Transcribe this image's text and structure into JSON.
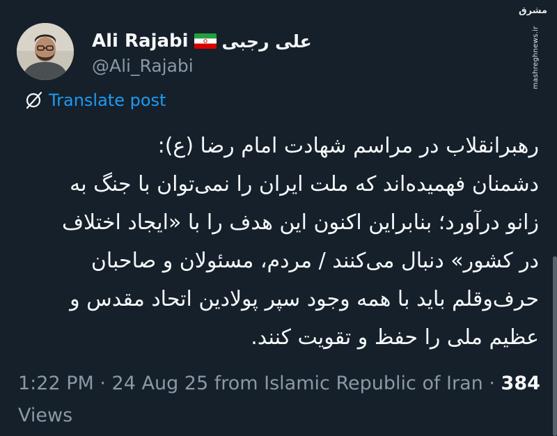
{
  "author": {
    "display_name": "Ali Rajabi",
    "flag_icon": "iran-flag-icon",
    "alt_name": "علی رجبی",
    "handle": "@Ali_Rajabi"
  },
  "watermark": {
    "logo_text": "مشرق",
    "url": "mashreghnews.ir"
  },
  "translate": {
    "icon": "translate-globe-icon",
    "label": "Translate post"
  },
  "tweet": {
    "lines": [
      "رهبرانقلاب در مراسم شهادت امام رضا (ع):",
      "دشمنان فهمیده‌اند که ملت ایران را نمی‌توان با جنگ به",
      "زانو درآورد؛ بنابراین اکنون این هدف را با «ایجاد اختلاف",
      "در کشور» دنبال می‌کنند / مردم، مسئولان و صاحبان",
      "حرف‌وقلم باید با همه وجود سپر پولادین اتحاد مقدس و",
      "عظیم ملی را حفظ و تقویت کنند."
    ]
  },
  "meta": {
    "time": "1:22 PM",
    "sep1": " · ",
    "date": "24 Aug 25",
    "source": " from Islamic Republic of Iran",
    "sep2": " · ",
    "views_count": "384",
    "views_label": "Views"
  },
  "colors": {
    "background": "#15202b",
    "text": "#f7f9f9",
    "muted": "#8b98a5",
    "link": "#1d9bf0"
  }
}
